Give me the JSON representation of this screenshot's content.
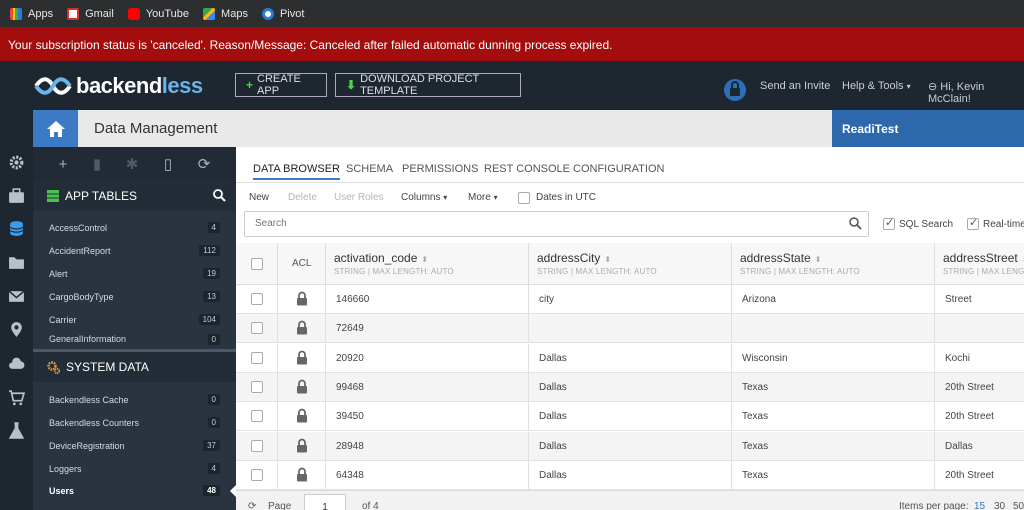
{
  "bookmarks": [
    {
      "label": "Apps",
      "icon": "apps-grid-icon",
      "color": "#e44"
    },
    {
      "label": "Gmail",
      "icon": "gmail-icon",
      "color": "#d93025"
    },
    {
      "label": "YouTube",
      "icon": "youtube-icon",
      "color": "#ff0000"
    },
    {
      "label": "Maps",
      "icon": "maps-icon",
      "color": "#34a853"
    },
    {
      "label": "Pivot",
      "icon": "pivot-icon",
      "color": "#2a7bd6"
    }
  ],
  "alert": {
    "text": "Your subscription status is 'canceled'. Reason/Message: Canceled after failed automatic dunning process expired."
  },
  "header": {
    "logo_part1": "backend",
    "logo_part2": "less",
    "create_app": "CREATE APP",
    "download_template": "DOWNLOAD PROJECT TEMPLATE",
    "send_invite": "Send an Invite",
    "help_tools": "Help & Tools",
    "user_greeting": "Hi, Kevin McClain!"
  },
  "title": {
    "page_title": "Data Management",
    "app_name": "ReadiTest"
  },
  "sidebar": {
    "app_tables_label": "APP TABLES",
    "app_tables": [
      {
        "name": "AccessControl",
        "count": "4"
      },
      {
        "name": "AccidentReport",
        "count": "112"
      },
      {
        "name": "Alert",
        "count": "19"
      },
      {
        "name": "CargoBodyType",
        "count": "13"
      },
      {
        "name": "Carrier",
        "count": "104"
      },
      {
        "name": "GeneralInformation",
        "count": "0"
      }
    ],
    "system_data_label": "SYSTEM DATA",
    "system_tables": [
      {
        "name": "Backendless Cache",
        "count": "0"
      },
      {
        "name": "Backendless Counters",
        "count": "0"
      },
      {
        "name": "DeviceRegistration",
        "count": "37"
      },
      {
        "name": "Loggers",
        "count": "4"
      },
      {
        "name": "Users",
        "count": "48"
      }
    ]
  },
  "tabs": [
    "DATA BROWSER",
    "SCHEMA",
    "PERMISSIONS",
    "REST CONSOLE",
    "CONFIGURATION"
  ],
  "actions": {
    "new": "New",
    "delete": "Delete",
    "user_roles": "User Roles",
    "columns": "Columns",
    "more": "More",
    "dates_utc": "Dates in UTC"
  },
  "search": {
    "placeholder": "Search",
    "sql_search": "SQL Search",
    "realtime": "Real-time"
  },
  "grid": {
    "acl_label": "ACL",
    "columns": [
      {
        "name": "activation_code",
        "sub": "STRING | MAX LENGTH: AUTO"
      },
      {
        "name": "addressCity",
        "sub": "STRING | MAX LENGTH: AUTO"
      },
      {
        "name": "addressState",
        "sub": "STRING | MAX LENGTH: AUTO"
      },
      {
        "name": "addressStreet",
        "sub": "STRING | MAX LENGTH: AUTO"
      }
    ],
    "rows": [
      [
        "146660",
        "city",
        "Arizona",
        "Street"
      ],
      [
        "72649",
        "",
        "",
        ""
      ],
      [
        "20920",
        "Dallas",
        "Wisconsin",
        "Kochi"
      ],
      [
        "99468",
        "Dallas",
        "Texas",
        "20th Street"
      ],
      [
        "39450",
        "Dallas",
        "Texas",
        "20th Street"
      ],
      [
        "28948",
        "Dallas",
        "Texas",
        "Dallas"
      ],
      [
        "64348",
        "Dallas",
        "Texas",
        "20th Street"
      ]
    ]
  },
  "pager": {
    "page_label": "Page",
    "page_value": "1",
    "of_label": "of 4",
    "items_per_page_label": "Items per page:",
    "options": [
      "15",
      "30",
      "50"
    ]
  },
  "colors": {
    "accent": "#3c7ac6",
    "alert": "#a30d0d",
    "header": "#1e2630",
    "sidebar": "#2a3440"
  }
}
